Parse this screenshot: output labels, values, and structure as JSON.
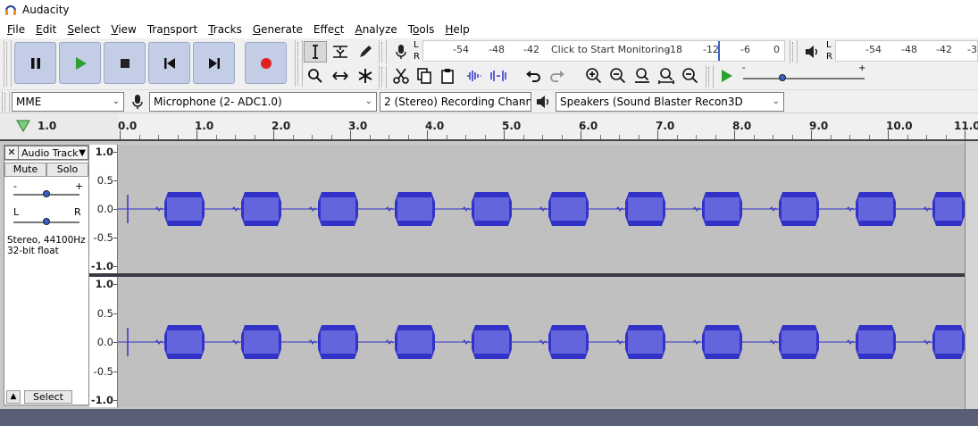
{
  "window": {
    "title": "Audacity"
  },
  "menu": [
    {
      "pre": "",
      "acc": "F",
      "post": "ile"
    },
    {
      "pre": "",
      "acc": "E",
      "post": "dit"
    },
    {
      "pre": "",
      "acc": "S",
      "post": "elect"
    },
    {
      "pre": "",
      "acc": "V",
      "post": "iew"
    },
    {
      "pre": "Tra",
      "acc": "n",
      "post": "sport"
    },
    {
      "pre": "",
      "acc": "T",
      "post": "racks"
    },
    {
      "pre": "",
      "acc": "G",
      "post": "enerate"
    },
    {
      "pre": "Effe",
      "acc": "c",
      "post": "t"
    },
    {
      "pre": "",
      "acc": "A",
      "post": "nalyze"
    },
    {
      "pre": "T",
      "acc": "o",
      "post": "ols"
    },
    {
      "pre": "",
      "acc": "H",
      "post": "elp"
    }
  ],
  "record_meter": {
    "label_l": "L",
    "label_r": "R",
    "scale": [
      "-54",
      "-48",
      "-42",
      "-18",
      "-12",
      "-6",
      "0"
    ],
    "prompt": "Click to Start Monitoring"
  },
  "play_meter": {
    "label_l": "L",
    "label_r": "R",
    "scale": [
      "-54",
      "-48",
      "-42",
      "-3"
    ]
  },
  "play_speed": {
    "minus": "-",
    "plus": "+"
  },
  "devices": {
    "host": "MME",
    "input": "Microphone (2- ADC1.0)",
    "channels": "2 (Stereo) Recording Chann",
    "output": "Speakers (Sound Blaster Recon3D"
  },
  "timeline": {
    "left_value": "1.0",
    "ticks": [
      "0.0",
      "1.0",
      "2.0",
      "3.0",
      "4.0",
      "5.0",
      "6.0",
      "7.0",
      "8.0",
      "9.0",
      "10.0",
      "11.0"
    ]
  },
  "track": {
    "name": "Audio Track",
    "close": "✕",
    "mute": "Mute",
    "solo": "Solo",
    "gain_minus": "-",
    "gain_plus": "+",
    "pan_left": "L",
    "pan_right": "R",
    "info_rate": "Stereo, 44100Hz",
    "info_format": "32-bit float",
    "select": "Select",
    "collapse": "▲"
  },
  "amplitude_ruler": [
    "1.0",
    "0.5",
    "0.0",
    "-0.5",
    "-1.0"
  ],
  "colors": {
    "waveform": "#3232c8",
    "waveform_rms": "#6464dc",
    "track_bg": "#c0c0c0",
    "transport_btn": "#c3cde6"
  }
}
